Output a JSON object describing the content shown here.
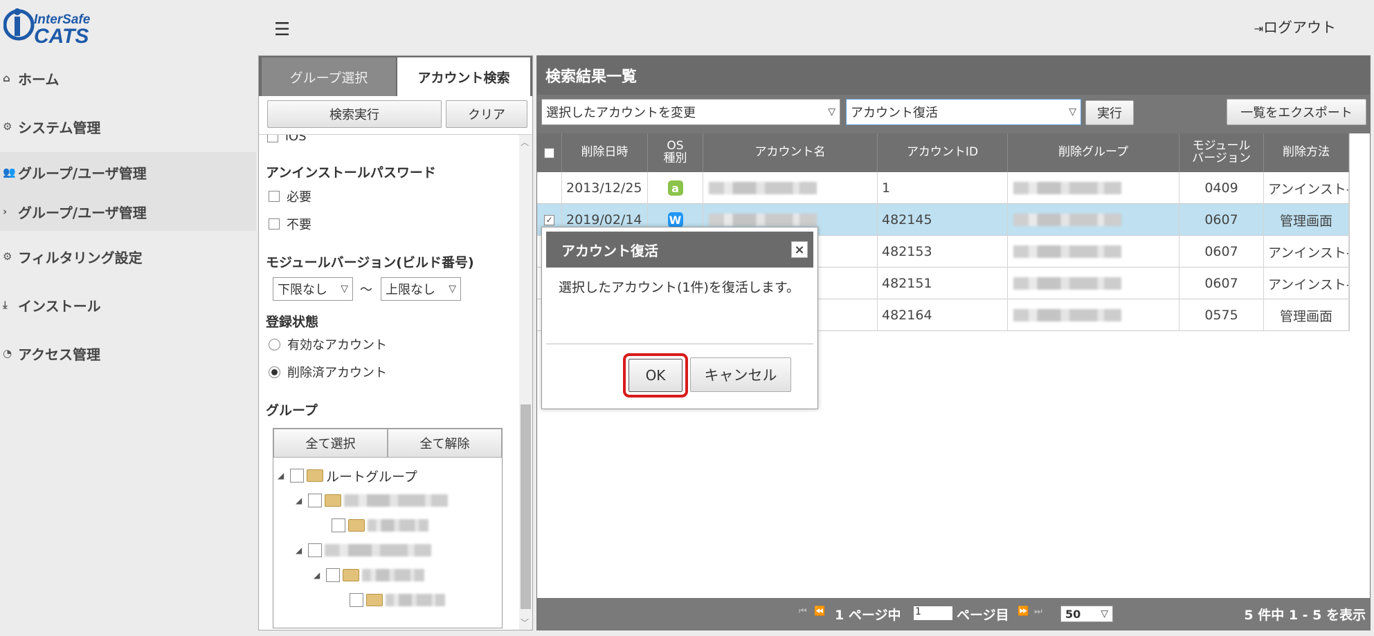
{
  "logo": {
    "line1": "InterSafe",
    "line2": "CATS"
  },
  "header": {
    "logout_label": "ログアウト"
  },
  "sidebar": {
    "items": [
      {
        "label": "ホーム",
        "icon": "home-icon"
      },
      {
        "label": "システム管理",
        "icon": "gear-icon"
      },
      {
        "label": "グループ/ユーザ管理",
        "icon": "users-icon"
      },
      {
        "label": "グループ/ユーザ管理",
        "icon": "chevron-right-icon"
      },
      {
        "label": "フィルタリング設定",
        "icon": "gears-icon"
      },
      {
        "label": "インストール",
        "icon": "download-icon"
      },
      {
        "label": "アクセス管理",
        "icon": "pie-chart-icon"
      }
    ]
  },
  "search_panel": {
    "tabs": [
      "グループ選択",
      "アカウント検索"
    ],
    "search_button": "検索実行",
    "clear_button": "クリア",
    "partial_label": "iOS",
    "uninstall_password": {
      "label": "アンインストールパスワード",
      "options": [
        "必要",
        "不要"
      ]
    },
    "module_version": {
      "label": "モジュールバージョン(ビルド番号)",
      "min": "下限なし",
      "sep": "〜",
      "max": "上限なし"
    },
    "reg_status": {
      "label": "登録状態",
      "options": [
        "有効なアカウント",
        "削除済アカウント"
      ],
      "selected": 1
    },
    "group": {
      "label": "グループ",
      "select_all": "全て選択",
      "deselect_all": "全て解除",
      "root": "ルートグループ"
    }
  },
  "results": {
    "title": "検索結果一覧",
    "action_select": "選択したアカウントを変更",
    "action_value": "アカウント復活",
    "execute_button": "実行",
    "export_button": "一覧をエクスポート",
    "columns": [
      "削除日時",
      "OS種別",
      "アカウント名",
      "アカウントID",
      "削除グループ",
      "モジュールバージョン",
      "削除方法"
    ],
    "col_os_1": "OS",
    "col_os_2": "種別",
    "col_mod_1": "モジュール",
    "col_mod_2": "バージョン",
    "rows": [
      {
        "date": "2013/12/25",
        "os": "a",
        "os_color": "#8bc34a",
        "id": "1",
        "version": "0409",
        "method": "アンインスト-",
        "checked": false
      },
      {
        "date": "2019/02/14",
        "os": "W",
        "os_color": "#2196f3",
        "id": "482145",
        "version": "0607",
        "method": "管理画面",
        "checked": true
      },
      {
        "date": "",
        "os": "",
        "os_color": "",
        "id": "482153",
        "version": "0607",
        "method": "アンインスト-",
        "checked": false
      },
      {
        "date": "",
        "os": "",
        "os_color": "",
        "id": "482151",
        "version": "0607",
        "method": "アンインスト-",
        "checked": false
      },
      {
        "date": "",
        "os": "",
        "os_color": "",
        "id": "482164",
        "version": "0575",
        "method": "管理画面",
        "checked": false
      }
    ],
    "footer": {
      "page_text_1": "1 ページ中",
      "page_input": "1",
      "page_text_2": "ページ目",
      "per_page": "50",
      "summary": "5 件中 1 - 5 を表示"
    }
  },
  "dialog": {
    "title": "アカウント復活",
    "message": "選択したアカウント(1件)を復活します。",
    "ok": "OK",
    "cancel": "キャンセル"
  }
}
